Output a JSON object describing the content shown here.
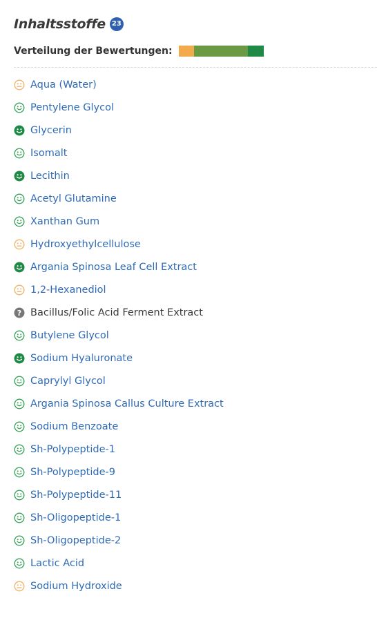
{
  "header": {
    "title": "Inhaltsstoffe",
    "count": "23"
  },
  "distribution": {
    "label": "Verteilung der Bewertungen:",
    "segments": [
      {
        "rating": "acceptable",
        "share": 0.18,
        "color": "#f2aa4c"
      },
      {
        "rating": "good",
        "share": 0.64,
        "color": "#6a9a44"
      },
      {
        "rating": "very-good",
        "share": 0.18,
        "color": "#1e8a45"
      }
    ]
  },
  "colors": {
    "very_good": "#1e8a45",
    "good": "#3aa35a",
    "acceptable": "#f2b36a",
    "unknown": "#777777",
    "link": "#2f6ab5"
  },
  "ingredients": [
    {
      "name": "Aqua (Water)",
      "rating": "acceptable",
      "icon": "neutral-face-icon",
      "link": true
    },
    {
      "name": "Pentylene Glycol",
      "rating": "good",
      "icon": "smile-face-icon",
      "link": true
    },
    {
      "name": "Glycerin",
      "rating": "very-good",
      "icon": "smile-face-icon",
      "link": true
    },
    {
      "name": "Isomalt",
      "rating": "good",
      "icon": "smile-face-icon",
      "link": true
    },
    {
      "name": "Lecithin",
      "rating": "very-good",
      "icon": "smile-face-icon",
      "link": true
    },
    {
      "name": "Acetyl Glutamine",
      "rating": "good",
      "icon": "smile-face-icon",
      "link": true
    },
    {
      "name": "Xanthan Gum",
      "rating": "good",
      "icon": "smile-face-icon",
      "link": true
    },
    {
      "name": "Hydroxyethylcellulose",
      "rating": "acceptable",
      "icon": "neutral-face-icon",
      "link": true
    },
    {
      "name": "Argania Spinosa Leaf Cell Extract",
      "rating": "very-good",
      "icon": "smile-face-icon",
      "link": true
    },
    {
      "name": "1,2-Hexanediol",
      "rating": "acceptable",
      "icon": "neutral-face-icon",
      "link": true
    },
    {
      "name": "Bacillus/Folic Acid Ferment Extract",
      "rating": "unknown",
      "icon": "question-icon",
      "link": false
    },
    {
      "name": "Butylene Glycol",
      "rating": "good",
      "icon": "smile-face-icon",
      "link": true
    },
    {
      "name": "Sodium Hyaluronate",
      "rating": "very-good",
      "icon": "smile-face-icon",
      "link": true
    },
    {
      "name": "Caprylyl Glycol",
      "rating": "good",
      "icon": "smile-face-icon",
      "link": true
    },
    {
      "name": "Argania Spinosa Callus Culture Extract",
      "rating": "good",
      "icon": "smile-face-icon",
      "link": true
    },
    {
      "name": "Sodium Benzoate",
      "rating": "good",
      "icon": "smile-face-icon",
      "link": true
    },
    {
      "name": "Sh-Polypeptide-1",
      "rating": "good",
      "icon": "smile-face-icon",
      "link": true
    },
    {
      "name": "Sh-Polypeptide-9",
      "rating": "good",
      "icon": "smile-face-icon",
      "link": true
    },
    {
      "name": "Sh-Polypeptide-11",
      "rating": "good",
      "icon": "smile-face-icon",
      "link": true
    },
    {
      "name": "Sh-Oligopeptide-1",
      "rating": "good",
      "icon": "smile-face-icon",
      "link": true
    },
    {
      "name": "Sh-Oligopeptide-2",
      "rating": "good",
      "icon": "smile-face-icon",
      "link": true
    },
    {
      "name": "Lactic Acid",
      "rating": "good",
      "icon": "smile-face-icon",
      "link": true
    },
    {
      "name": "Sodium Hydroxide",
      "rating": "acceptable",
      "icon": "neutral-face-icon",
      "link": true
    }
  ]
}
